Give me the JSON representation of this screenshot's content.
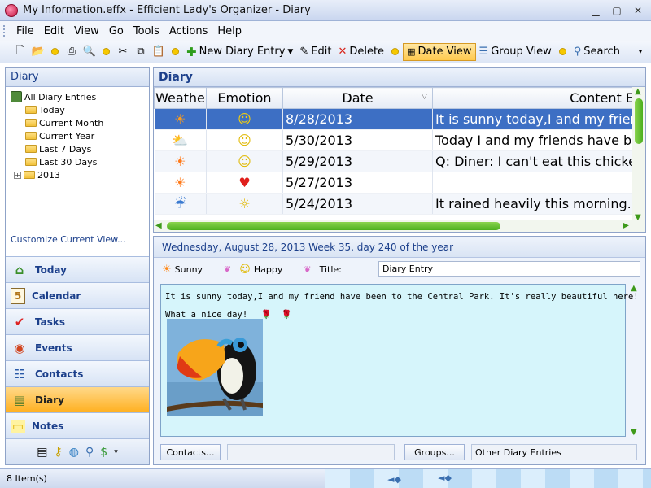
{
  "window": {
    "title": "My Information.effx - Efficient Lady's Organizer - Diary"
  },
  "menu": [
    "File",
    "Edit",
    "View",
    "Go",
    "Tools",
    "Actions",
    "Help"
  ],
  "toolbar": {
    "new_diary_entry": "New Diary Entry",
    "edit": "Edit",
    "delete": "Delete",
    "date_view": "Date View",
    "group_view": "Group View",
    "search": "Search"
  },
  "left_panel": {
    "header": "Diary",
    "tree_root": "All Diary Entries",
    "tree_children": [
      "Today",
      "Current Month",
      "Current Year",
      "Last 7 Days",
      "Last 30 Days",
      "2013"
    ],
    "customize_link": "Customize Current View...",
    "nav": [
      {
        "label": "Today",
        "icon": "home-icon",
        "glyph": "⌂"
      },
      {
        "label": "Calendar",
        "icon": "calendar-icon",
        "glyph": "5"
      },
      {
        "label": "Tasks",
        "icon": "tasks-icon",
        "glyph": "✔"
      },
      {
        "label": "Events",
        "icon": "events-icon",
        "glyph": "◉"
      },
      {
        "label": "Contacts",
        "icon": "contacts-icon",
        "glyph": "☷"
      },
      {
        "label": "Diary",
        "icon": "diary-icon",
        "glyph": "▤"
      },
      {
        "label": "Notes",
        "icon": "notes-icon",
        "glyph": "▭"
      }
    ],
    "active_nav": "Diary"
  },
  "diary_list": {
    "header": "Diary",
    "columns": [
      "Weathe",
      "Emotion",
      "Date",
      "Content E"
    ],
    "rows": [
      {
        "weather": "☀",
        "emotion": "☺",
        "date": "8/28/2013",
        "content": "It is sunny today,I and my friend",
        "selected": true
      },
      {
        "weather": "⛅",
        "emotion": "☺",
        "date": "5/30/2013",
        "content": "Today I and my friends have bee",
        "selected": false
      },
      {
        "weather": "☀",
        "emotion": "☺",
        "date": "5/29/2013",
        "content": "Q: Diner: I can't eat this chicken",
        "selected": false
      },
      {
        "weather": "☀",
        "emotion": "♥",
        "date": "5/27/2013",
        "content": "",
        "selected": false
      },
      {
        "weather": "☔",
        "emotion": "☼",
        "date": "5/24/2013",
        "content": "It rained heavily this morning. U",
        "selected": false
      }
    ]
  },
  "detail": {
    "date_line": "Wednesday, August 28, 2013  Week 35, day 240 of the year",
    "weather": "Sunny",
    "emotion": "Happy",
    "title_label": "Title:",
    "title_value": "Diary Entry",
    "body_line1": "It is sunny today,I and my friend have been to the Central Park. It's really beautiful here!",
    "body_line2": "What a nice day!",
    "contacts_button": "Contacts...",
    "groups_button": "Groups...",
    "other_entries": "Other Diary Entries"
  },
  "status": {
    "items": "8 Item(s)"
  },
  "colors": {
    "selection": "#3d6fc4",
    "accent": "#1b3f8b",
    "active_nav": "#ffb020",
    "editor_bg": "#d6f5fb"
  }
}
